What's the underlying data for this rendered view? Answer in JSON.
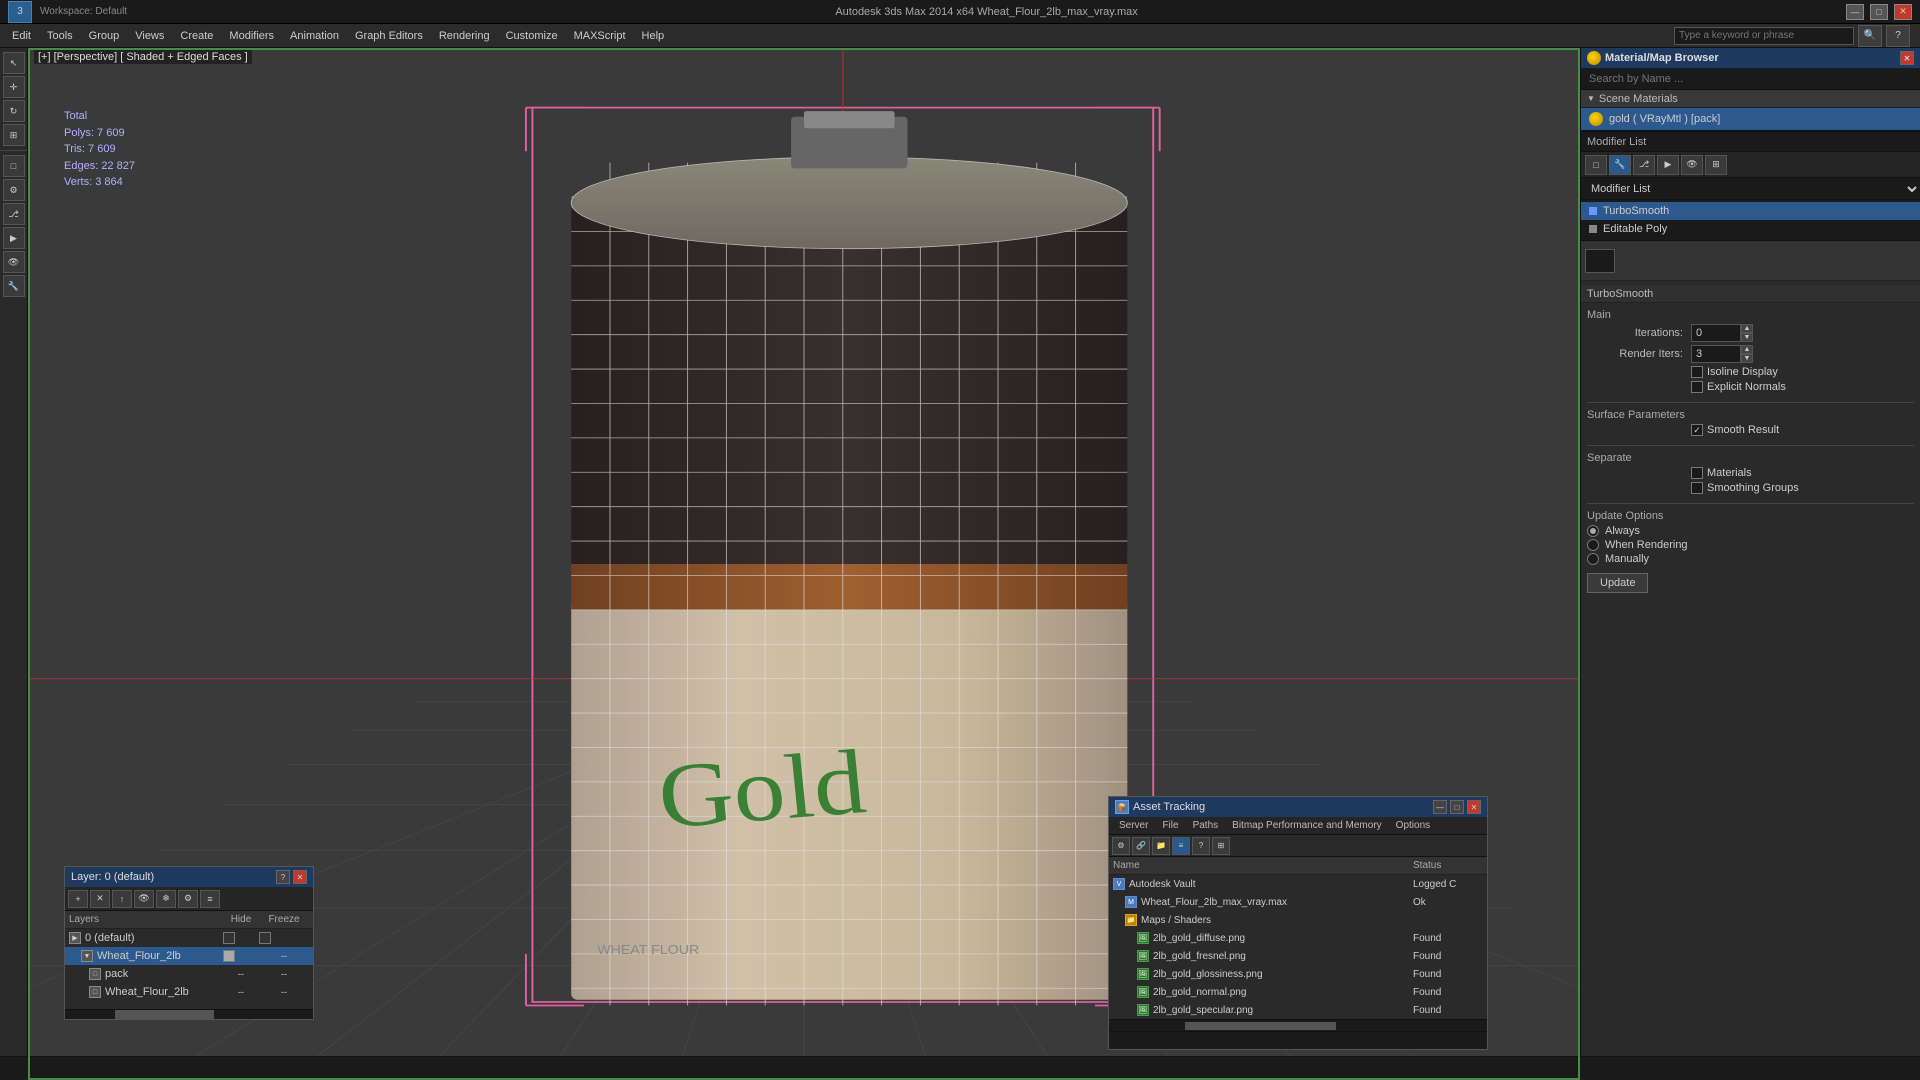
{
  "app": {
    "title": "Autodesk 3ds Max 2014 x64    Wheat_Flour_2lb_max_vray.max",
    "workspace": "Workspace: Default"
  },
  "titlebar": {
    "minimize": "—",
    "maximize": "□",
    "close": "✕"
  },
  "menubar": {
    "items": [
      "Edit",
      "Tools",
      "Group",
      "Views",
      "Create",
      "Modifiers",
      "Animation",
      "Graph Editors",
      "Rendering",
      "Customize",
      "MAXScript",
      "Help"
    ]
  },
  "viewport": {
    "label": "[+] [Perspective] [ Shaded + Edged Faces ]",
    "stats": {
      "polys_label": "Polys:",
      "polys_value": "7 609",
      "tris_label": "Tris:",
      "tris_value": "7 609",
      "edges_label": "Edges:",
      "edges_value": "22 827",
      "verts_label": "Verts:",
      "verts_value": "3 864",
      "total_label": "Total"
    }
  },
  "material_map_browser": {
    "title": "Material/Map Browser",
    "search_placeholder": "Search by Name ...",
    "scene_materials_label": "Scene Materials",
    "material_item": "gold  ( VRayMtl ) [pack]"
  },
  "modifier_panel": {
    "title": "Modifier List",
    "dropdown_label": "Modifier List",
    "items": [
      {
        "label": "TurboSmooth",
        "active": true
      },
      {
        "label": "Editable Poly",
        "active": false
      }
    ]
  },
  "turbosmoooth": {
    "title": "TurboSmooth",
    "main_label": "Main",
    "iterations_label": "Iterations:",
    "iterations_value": "0",
    "render_iters_label": "Render Iters:",
    "render_iters_value": "3",
    "isoline_display_label": "Isoline Display",
    "explicit_normals_label": "Explicit Normals",
    "surface_params_label": "Surface Parameters",
    "smooth_result_label": "Smooth Result",
    "smooth_result_checked": true,
    "separate_label": "Separate",
    "materials_label": "Materials",
    "smoothing_groups_label": "Smoothing Groups",
    "update_options_label": "Update Options",
    "always_label": "Always",
    "when_rendering_label": "When Rendering",
    "manually_label": "Manually",
    "update_btn": "Update"
  },
  "layer_panel": {
    "title": "Layer: 0 (default)",
    "col_name": "Layers",
    "col_hide": "Hide",
    "col_freeze": "Freeze",
    "rows": [
      {
        "label": "0 (default)",
        "level": 0,
        "selected": false
      },
      {
        "label": "Wheat_Flour_2lb",
        "level": 1,
        "selected": true
      },
      {
        "label": "pack",
        "level": 2,
        "selected": false
      },
      {
        "label": "Wheat_Flour_2lb",
        "level": 2,
        "selected": false
      }
    ]
  },
  "asset_tracking": {
    "title": "Asset Tracking",
    "menu_items": [
      "Server",
      "File",
      "Paths",
      "Bitmap Performance and Memory",
      "Options"
    ],
    "col_name": "Name",
    "col_status": "Status",
    "rows": [
      {
        "label": "Autodesk Vault",
        "level": 0,
        "status": "Logged C",
        "icon": "vault"
      },
      {
        "label": "Wheat_Flour_2lb_max_vray.max",
        "level": 1,
        "status": "Ok",
        "icon": "file"
      },
      {
        "label": "Maps / Shaders",
        "level": 1,
        "status": "",
        "icon": "folder"
      },
      {
        "label": "2lb_gold_diffuse.png",
        "level": 2,
        "status": "Found",
        "icon": "image"
      },
      {
        "label": "2lb_gold_fresnel.png",
        "level": 2,
        "status": "Found",
        "icon": "image"
      },
      {
        "label": "2lb_gold_glossiness.png",
        "level": 2,
        "status": "Found",
        "icon": "image"
      },
      {
        "label": "2lb_gold_normal.png",
        "level": 2,
        "status": "Found",
        "icon": "image"
      },
      {
        "label": "2lb_gold_specular.png",
        "level": 2,
        "status": "Found",
        "icon": "image"
      }
    ]
  },
  "status_bar": {
    "text": ""
  }
}
